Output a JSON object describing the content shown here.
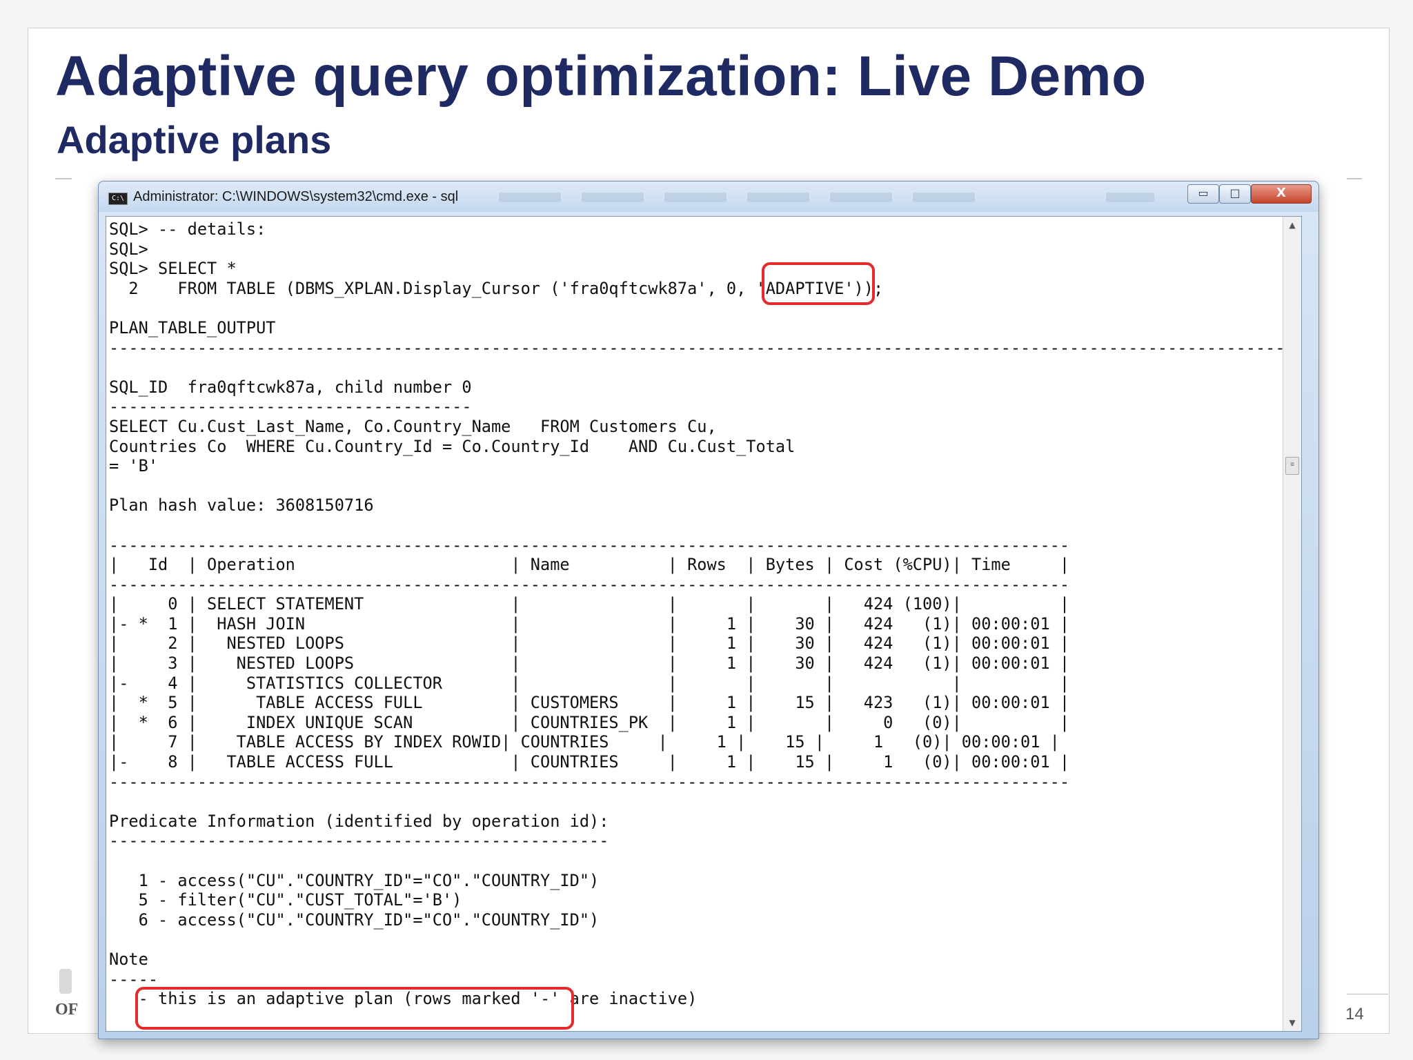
{
  "slide": {
    "title": "Adaptive query optimization: Live Demo",
    "subtitle": "Adaptive plans",
    "page_number": "14",
    "footer_logo": "OF"
  },
  "window": {
    "title": "Administrator: C:\\WINDOWS\\system32\\cmd.exe - sql",
    "minimize_glyph": "▭",
    "maximize_glyph": "□",
    "close_glyph": "X"
  },
  "console": {
    "lines": [
      "SQL> -- details:",
      "SQL>",
      "SQL> SELECT *",
      "  2    FROM TABLE (DBMS_XPLAN.Display_Cursor ('fra0qftcwk87a', 0, 'ADAPTIVE'));",
      "",
      "PLAN_TABLE_OUTPUT",
      "------------------------------------------------------------------------------------------------------------------------",
      "",
      "SQL_ID  fra0qftcwk87a, child number 0",
      "-------------------------------------",
      "SELECT Cu.Cust_Last_Name, Co.Country_Name   FROM Customers Cu,",
      "Countries Co  WHERE Cu.Country_Id = Co.Country_Id    AND Cu.Cust_Total",
      "= 'B'",
      "",
      "Plan hash value: 3608150716",
      "",
      "--------------------------------------------------------------------------------------------------",
      "|   Id  | Operation                      | Name          | Rows  | Bytes | Cost (%CPU)| Time     |",
      "--------------------------------------------------------------------------------------------------",
      "|     0 | SELECT STATEMENT               |               |       |       |   424 (100)|          |",
      "|- *  1 |  HASH JOIN                     |               |     1 |    30 |   424   (1)| 00:00:01 |",
      "|     2 |   NESTED LOOPS                 |               |     1 |    30 |   424   (1)| 00:00:01 |",
      "|     3 |    NESTED LOOPS                |               |     1 |    30 |   424   (1)| 00:00:01 |",
      "|-    4 |     STATISTICS COLLECTOR       |               |       |       |            |          |",
      "|  *  5 |      TABLE ACCESS FULL         | CUSTOMERS     |     1 |    15 |   423   (1)| 00:00:01 |",
      "|  *  6 |     INDEX UNIQUE SCAN          | COUNTRIES_PK  |     1 |       |     0   (0)|          |",
      "|     7 |    TABLE ACCESS BY INDEX ROWID| COUNTRIES     |     1 |    15 |     1   (0)| 00:00:01 |",
      "|-    8 |   TABLE ACCESS FULL            | COUNTRIES     |     1 |    15 |     1   (0)| 00:00:01 |",
      "--------------------------------------------------------------------------------------------------",
      "",
      "Predicate Information (identified by operation id):",
      "---------------------------------------------------",
      "",
      "   1 - access(\"CU\".\"COUNTRY_ID\"=\"CO\".\"COUNTRY_ID\")",
      "   5 - filter(\"CU\".\"CUST_TOTAL\"='B')",
      "   6 - access(\"CU\".\"COUNTRY_ID\"=\"CO\".\"COUNTRY_ID\")",
      "",
      "Note",
      "-----",
      "   - this is an adaptive plan (rows marked '-' are inactive)"
    ]
  },
  "colors": {
    "title": "#1f2a63",
    "highlight": "#e32b2b"
  }
}
